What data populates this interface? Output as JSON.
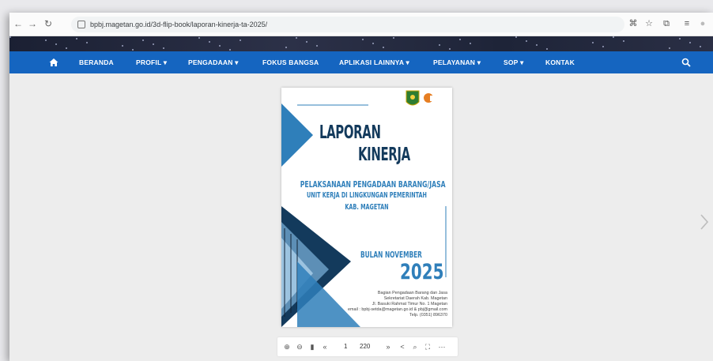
{
  "browser": {
    "url": "bpbj.magetan.go.id/3d-flip-book/laporan-kinerja-ta-2025/",
    "icons": [
      "back-icon",
      "forward-icon",
      "reload-icon",
      "site-settings-icon",
      "translate-icon",
      "bookmark-star-icon",
      "extensions-icon",
      "reading-list-icon",
      "profile-icon"
    ]
  },
  "nav": {
    "items": [
      {
        "label": "BERANDA"
      },
      {
        "label": "PROFIL ▾"
      },
      {
        "label": "PENGADAAN ▾"
      },
      {
        "label": "FOKUS BANGSA"
      },
      {
        "label": "APLIKASI LAINNYA ▾"
      },
      {
        "label": "PELAYANAN ▾"
      },
      {
        "label": "SOP ▾"
      },
      {
        "label": "KONTAK"
      }
    ],
    "color": "#1565c0"
  },
  "document": {
    "title_line1": "LAPORAN",
    "title_line2": "KINERJA",
    "subtitle_line1": "PELAKSANAAN PENGADAAN BARANG/JASA",
    "subtitle_line2": "UNIT KERJA DI LINGKUNGAN PEMERINTAH",
    "subtitle_line3": "KAB. MAGETAN",
    "month": "BULAN NOVEMBER",
    "year": "2025",
    "address": [
      "Bagian Pengadaan Barang dan Jasa",
      "Sekretariat Daerah Kab. Magetan",
      "Jl. Basuki Rahmat Timur No. 1 Magetan",
      "email : bpbj-setda@magetan.go.id & pbj@gmail.com",
      "Telp. (0351) 896370"
    ],
    "logo_text": "UKPBJ",
    "accent": "#2f7fba",
    "dark": "#133a5c"
  },
  "toolbar": {
    "current_page": "1",
    "total_pages": "220",
    "icons": [
      "zoom-in-icon",
      "zoom-out-icon",
      "bookmark-icon",
      "first-page-icon",
      "last-page-icon",
      "share-icon",
      "search-icon",
      "fullscreen-icon",
      "more-icon"
    ]
  }
}
